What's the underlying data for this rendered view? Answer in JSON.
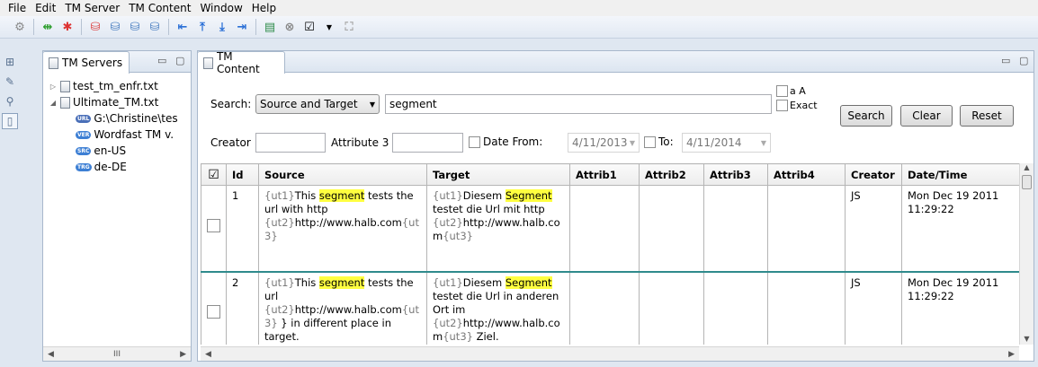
{
  "menu": [
    "File",
    "Edit",
    "TM Server",
    "TM Content",
    "Window",
    "Help"
  ],
  "toolbar_icons": [
    "settings-icon",
    "add-icon",
    "remove-icon",
    "delete-red-icon",
    "db-icon",
    "db2-icon",
    "db3-icon",
    "first-icon",
    "up-icon",
    "down-icon",
    "last-icon",
    "export-icon",
    "cancel-icon",
    "checkbox-icon",
    "dropdown-icon",
    "clear-icon"
  ],
  "servers_panel": {
    "tab_label": "TM Servers",
    "tree": {
      "node1": "test_tm_enfr.txt",
      "node2": "Ultimate_TM.txt",
      "child_url": "G:\\Christine\\tes",
      "child_ver": "Wordfast TM v.",
      "child_src": "en-US",
      "child_trg": "de-DE",
      "badge_url": "URL",
      "badge_ver": "VER",
      "badge_src": "SRC",
      "badge_trg": "TRG"
    }
  },
  "content_panel": {
    "tab_label": "TM Content",
    "search_label": "Search:",
    "search_scope": "Source and Target",
    "search_value": "segment",
    "case_label": "a A",
    "exact_label": "Exact",
    "search_button": "Search",
    "clear_button": "Clear",
    "reset_button": "Reset",
    "creator_label": "Creator",
    "attr3_label": "Attribute 3",
    "date_from_label": "Date From:",
    "date_from_value": "4/11/2013",
    "to_label": "To:",
    "date_to_value": "4/11/2014"
  },
  "grid": {
    "headers": [
      "Id",
      "Source",
      "Target",
      "Attrib1",
      "Attrib2",
      "Attrib3",
      "Attrib4",
      "Creator",
      "Date/Time"
    ],
    "rows": [
      {
        "id": "1",
        "src_t1": "{ut1}",
        "src_a": "This ",
        "src_hl": "segment",
        "src_b": " tests the url with http",
        "src_t2": "{ut2}",
        "src_c": "http://www.halb.com",
        "src_t3": "{ut3}",
        "src_d": "",
        "tgt_t1": "{ut1}",
        "tgt_a": "Diesem ",
        "tgt_hl": "Segment",
        "tgt_b": " testet die Url mit http",
        "tgt_t2": "{ut2}",
        "tgt_c": "http://www.halb.co m",
        "tgt_t3": "{ut3}",
        "tgt_d": "",
        "creator": "JS",
        "date": "Mon Dec 19 2011 11:29:22"
      },
      {
        "id": "2",
        "src_t1": "{ut1}",
        "src_a": "This ",
        "src_hl": "segment",
        "src_b": " tests the url",
        "src_t2": "{ut2}",
        "src_c": "http://www.halb.com",
        "src_t3": "{ut3}",
        "src_d": " } in different place in target.",
        "tgt_t1": "{ut1}",
        "tgt_a": "Diesem ",
        "tgt_hl": "Segment",
        "tgt_b": " testet die Url in anderen Ort im",
        "tgt_t2": "{ut2}",
        "tgt_c": "http://www.halb.co m",
        "tgt_t3": "{ut3}",
        "tgt_d": " Ziel.",
        "creator": "JS",
        "date": "Mon Dec 19 2011 11:29:22"
      }
    ]
  },
  "scroll_glyphs": {
    "left": "◀",
    "right": "▶",
    "grip": "III",
    "up": "▲",
    "down": "▼"
  },
  "colors": {
    "highlight": "#ffff40",
    "row_divider": "#2f8a8c",
    "background": "#dfe7f1"
  }
}
